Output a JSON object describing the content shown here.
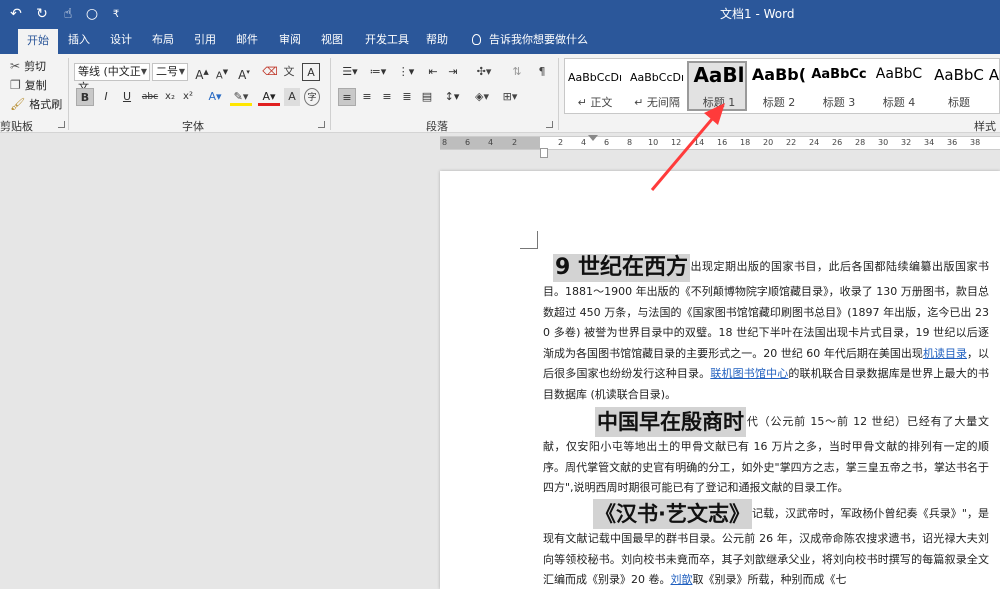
{
  "window": {
    "title": "文档1  -  Word"
  },
  "quick_access": {
    "undo": "↶",
    "redo": "↻",
    "touch": "☝",
    "circle": "○",
    "more": "₹"
  },
  "tabs": [
    "开始",
    "插入",
    "设计",
    "布局",
    "引用",
    "邮件",
    "审阅",
    "视图",
    "开发工具",
    "帮助"
  ],
  "tell_me": "告诉我你想要做什么",
  "clipboard": {
    "cut": "剪切",
    "copy": "复制",
    "format_painter": "格式刷",
    "group_label": "剪贴板"
  },
  "font": {
    "family": "等线 (中文正文",
    "size": "二号",
    "grow": "A",
    "shrink": "A",
    "clear": "A",
    "bold": "B",
    "italic": "I",
    "underline": "U",
    "strike": "abc",
    "subscript": "x₂",
    "superscript": "x²",
    "group_label": "字体"
  },
  "paragraph": {
    "group_label": "段落"
  },
  "styles": {
    "group_label": "样式",
    "items": [
      {
        "preview": "AaBbCcDı",
        "name": "↵ 正文"
      },
      {
        "preview": "AaBbCcDı",
        "name": "↵ 无间隔"
      },
      {
        "preview": "AaBl",
        "name": "标题 1"
      },
      {
        "preview": "AaBb(",
        "name": "标题 2"
      },
      {
        "preview": "AaBbCc",
        "name": "标题 3"
      },
      {
        "preview": "AaBbC",
        "name": "标题 4"
      },
      {
        "preview": "AaBbC",
        "name": "标题"
      },
      {
        "preview": "A",
        "name": ""
      }
    ]
  },
  "ruler": {
    "ticks": [
      "8",
      "6",
      "4",
      "2",
      "",
      "2",
      "4",
      "6",
      "8",
      "10",
      "12",
      "14",
      "16",
      "18",
      "20",
      "22",
      "24",
      "26",
      "28",
      "30",
      "32",
      "34",
      "36",
      "38"
    ]
  },
  "document": {
    "p1": {
      "heading": "9 世纪在西方",
      "text": "出现定期出版的国家书目，此后各国都陆续编纂出版国家书目。1881～1900 年出版的《不列颠博物院字顺馆藏目录》，收录了 130 万册图书，款目总数超过 450 万条，与法国的《国家图书馆馆藏印刷图书总目》(1897 年出版，迄今已出 230 多卷) 被誉为世界目录中的双璧。18 世纪下半叶在法国出现卡片式目录，19 世纪以后逐渐成为各国图书馆馆藏目录的主要形式之一。20 世纪 60 年代后期在美国出现",
      "link1": "机读目录",
      "text2": "，以后很多国家也纷纷发行这种目录。",
      "link2": "联机图书馆中心",
      "text3": "的联机联合目录数据库是世界上最大的书目数据库 (机读联合目录)。"
    },
    "p2": {
      "heading": "中国早在殷商时",
      "text": "代（公元前 15～前 12 世纪）已经有了大量文献，仅安阳小屯等地出土的甲骨文献已有 16 万片之多，当时甲骨文献的排列有一定的顺序。周代掌管文献的史官有明确的分工，如外史\"掌四方之志，掌三皇五帝之书，掌达书名于四方\",说明西周时期很可能已有了登记和通报文献的目录工作。"
    },
    "p3": {
      "heading": "《汉书·艺文志》",
      "text": "记载，汉武帝时，军政杨仆曾纪奏《兵录》\"，是现有文献记载中国最早的群书目录。公元前 26 年，汉成帝命陈农搜求遗书，诏光禄大夫刘向等领校秘书。刘向校书未竟而卒，其子刘歆继承父业，将刘向校书时撰写的每篇叙录全文汇编而成《别录》20 卷。",
      "link": "刘歆",
      "text2": "取《别录》所载，种别而成《七"
    }
  },
  "colors": {
    "brand": "#2b579a",
    "ribbon": "#f3f3f3",
    "highlight": "#d3d3d3",
    "link": "#1f5fbf",
    "arrow": "#ff3b3b"
  }
}
